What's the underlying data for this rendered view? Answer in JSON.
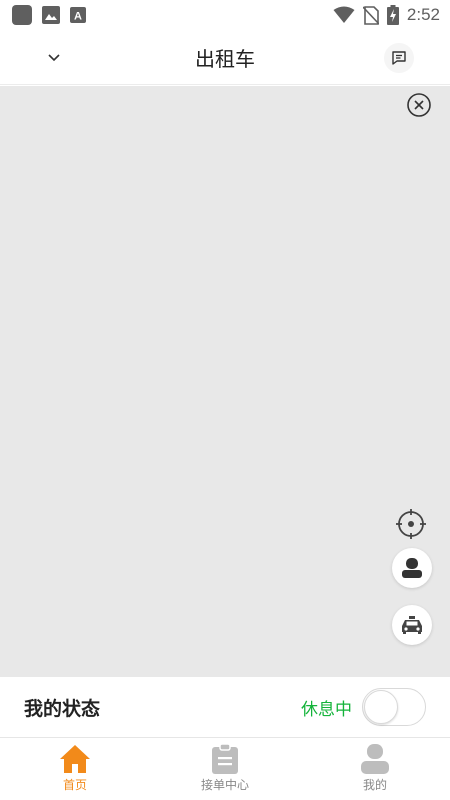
{
  "status_bar": {
    "time": "2:52"
  },
  "header": {
    "title": "出租车"
  },
  "driver_status": {
    "label": "我的状态",
    "state_text": "休息中",
    "toggle_on": false
  },
  "tabs": [
    {
      "label": "首页",
      "icon": "home-icon",
      "active": true
    },
    {
      "label": "接单中心",
      "icon": "clipboard-icon",
      "active": false
    },
    {
      "label": "我的",
      "icon": "person-icon",
      "active": false
    }
  ],
  "colors": {
    "accent": "#f28a1a",
    "status_green": "#14b33a",
    "map_bg": "#e8e8e8",
    "inactive_icon": "#bdbdbd"
  }
}
